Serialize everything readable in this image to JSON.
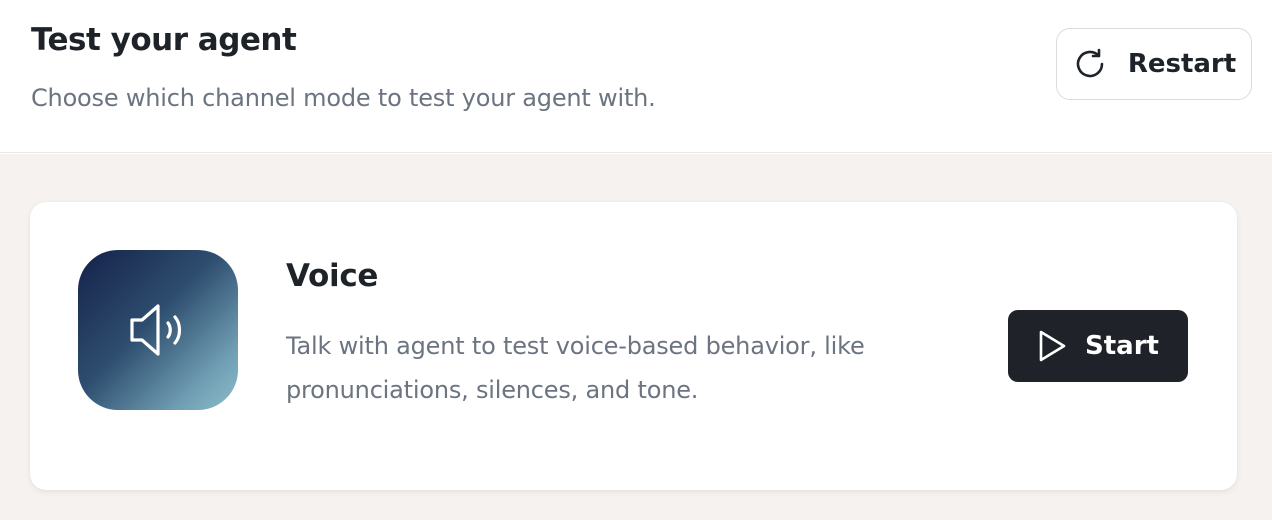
{
  "header": {
    "title": "Test your agent",
    "subtitle": "Choose which channel mode to test your agent with.",
    "restart_label": "Restart",
    "restart_icon": "restart-icon"
  },
  "modes": [
    {
      "title": "Voice",
      "description": "Talk with agent to test voice-based behavior, like pronunciations, silences, and tone.",
      "icon": "speaker-icon",
      "start_label": "Start",
      "start_icon": "play-icon"
    }
  ],
  "colors": {
    "text_primary": "#1e2329",
    "text_secondary": "#6b7480",
    "panel_background": "#f5f2ef",
    "button_dark": "#1f2329",
    "tile_gradient_start": "#14214a",
    "tile_gradient_end": "#8bbfcc"
  }
}
